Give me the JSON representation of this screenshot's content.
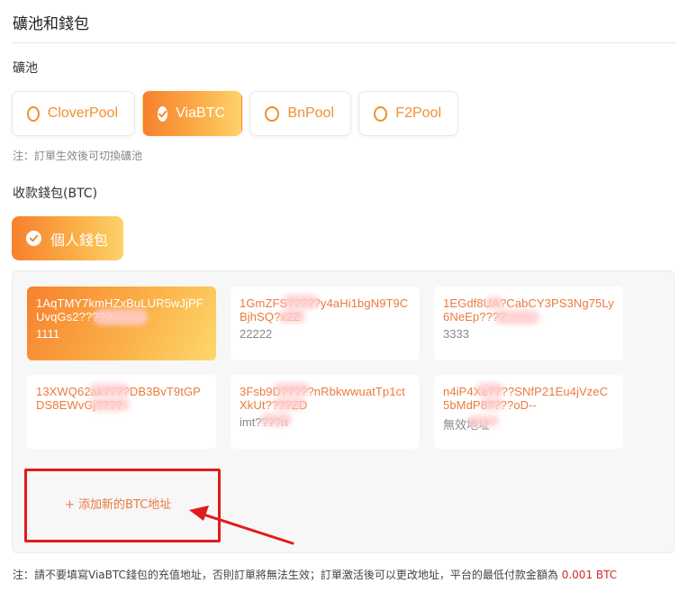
{
  "section_title": "礦池和錢包",
  "pool": {
    "label": "礦池",
    "options": [
      {
        "name": "CloverPool",
        "selected": false
      },
      {
        "name": "ViaBTC",
        "selected": true
      },
      {
        "name": "BnPool",
        "selected": false
      },
      {
        "name": "F2Pool",
        "selected": false
      }
    ],
    "note": "注：訂單生效後可切換礦池"
  },
  "wallet": {
    "label": "收款錢包(BTC)",
    "type_label": "個人錢包",
    "addresses": [
      {
        "address": "1AqTMY7kmHZxBuLUR5wJjPFUvqGs2?????",
        "name": "1111",
        "selected": true
      },
      {
        "address": "1GmZFS?????y4aHi1bgN9T9CBjhSQ?x2Z",
        "name": "22222",
        "selected": false
      },
      {
        "address": "1EGdf8UA?CabCY3PS3Ng75Ly6NeEp????",
        "name": "3333",
        "selected": false
      },
      {
        "address": "13XWQ62ak????DB3BvT9tGPDS8EWvGj????",
        "name": "",
        "selected": false
      },
      {
        "address": "3Fsb9D?????nRbkwwuatTp1ctXkUt????ZD",
        "name": "imt????n",
        "selected": false
      },
      {
        "address": "n4iP4Xe????SNfP21Eu4jVzeC5bMdP8????oD--",
        "name": "無效地址",
        "selected": false
      }
    ],
    "add_label": "+ 添加新的BTC地址"
  },
  "footnote": {
    "text": "注：請不要填寫ViaBTC錢包的充值地址，否則訂單將無法生效；訂單激活後可以更改地址，平台的最低付款金額為",
    "amount": "0.001 BTC"
  },
  "colors": {
    "accent": "#f0902e",
    "annotation": "#e11b1b",
    "amount": "#d42a2a"
  }
}
